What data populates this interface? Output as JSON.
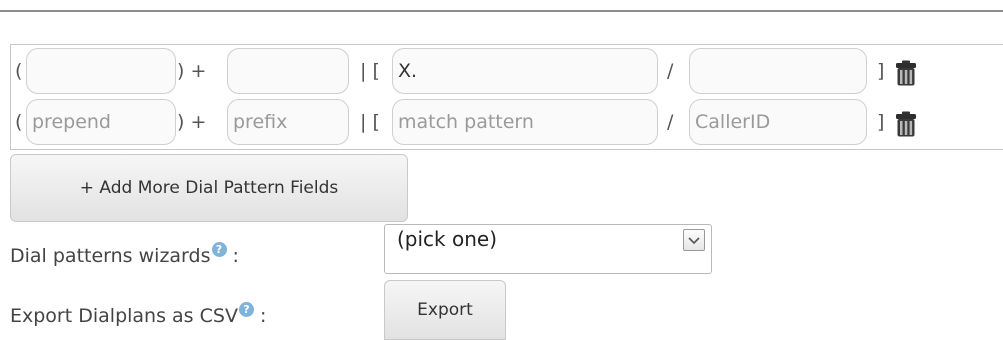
{
  "dial_patterns": {
    "rows": [
      {
        "prepend": "",
        "prefix": "",
        "match_pattern": "X.",
        "caller_id": "",
        "prepend_placeholder": "",
        "prefix_placeholder": "",
        "match_pattern_placeholder": "",
        "caller_id_placeholder": ""
      },
      {
        "prepend": "",
        "prefix": "",
        "match_pattern": "",
        "caller_id": "",
        "prepend_placeholder": "prepend",
        "prefix_placeholder": "prefix",
        "match_pattern_placeholder": "match pattern",
        "caller_id_placeholder": "CallerID"
      }
    ],
    "separators": {
      "open_paren": "(",
      "close_paren_plus": ") +",
      "pipe_bracket": "| [",
      "slash": "/",
      "close_bracket": "]"
    },
    "delete_icon": "trash-icon"
  },
  "add_button_label": "+ Add More Dial Pattern Fields",
  "wizard": {
    "label": "Dial patterns wizards",
    "help_glyph": "?",
    "colon": ":",
    "selected": "(pick one)"
  },
  "export": {
    "label": "Export Dialplans as CSV",
    "help_glyph": "?",
    "colon": ":",
    "button_label": "Export"
  },
  "colors": {
    "help_badge": "#7fb3d9",
    "border": "#c8c8c8"
  }
}
